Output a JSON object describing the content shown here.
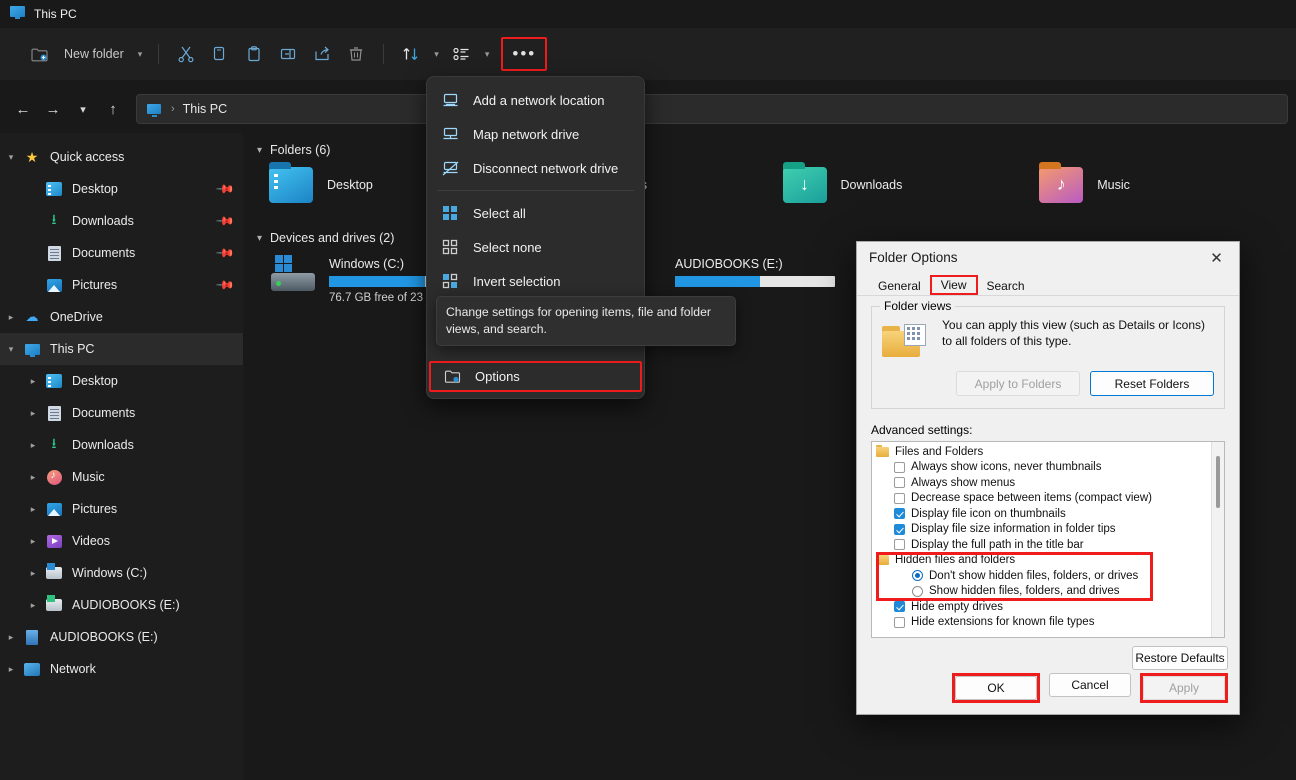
{
  "window": {
    "title": "This PC",
    "icon": "monitor-icon"
  },
  "toolbar": {
    "new_folder_label": "New folder",
    "icons": [
      "cut-icon",
      "copy-icon",
      "paste-icon",
      "rename-icon",
      "share-icon",
      "delete-icon",
      "sort-icon",
      "view-icon"
    ],
    "more_label": "•••"
  },
  "address": {
    "nav": [
      "back-arrow",
      "forward-arrow",
      "recent-chevron",
      "up-arrow"
    ],
    "crumb": "This PC"
  },
  "sidebar": {
    "items": [
      {
        "label": "Quick access",
        "icon": "star-icon",
        "expander": "chevron-down",
        "indent": 0,
        "pinned": false,
        "selected": false
      },
      {
        "label": "Desktop",
        "icon": "folder-desktop-icon",
        "expander": "",
        "indent": 1,
        "pinned": true,
        "selected": false
      },
      {
        "label": "Downloads",
        "icon": "downloads-icon",
        "expander": "",
        "indent": 1,
        "pinned": true,
        "selected": false
      },
      {
        "label": "Documents",
        "icon": "documents-icon",
        "expander": "",
        "indent": 1,
        "pinned": true,
        "selected": false
      },
      {
        "label": "Pictures",
        "icon": "pictures-icon",
        "expander": "",
        "indent": 1,
        "pinned": true,
        "selected": false
      },
      {
        "label": "OneDrive",
        "icon": "cloud-icon",
        "expander": "chevron-right",
        "indent": 0,
        "pinned": false,
        "selected": false
      },
      {
        "label": "This PC",
        "icon": "monitor-icon",
        "expander": "chevron-down",
        "indent": 0,
        "pinned": false,
        "selected": true
      },
      {
        "label": "Desktop",
        "icon": "folder-desktop-icon",
        "expander": "chevron-right",
        "indent": 1,
        "pinned": false,
        "selected": false
      },
      {
        "label": "Documents",
        "icon": "documents-icon",
        "expander": "chevron-right",
        "indent": 1,
        "pinned": false,
        "selected": false
      },
      {
        "label": "Downloads",
        "icon": "downloads-icon",
        "expander": "chevron-right",
        "indent": 1,
        "pinned": false,
        "selected": false
      },
      {
        "label": "Music",
        "icon": "music-icon",
        "expander": "chevron-right",
        "indent": 1,
        "pinned": false,
        "selected": false
      },
      {
        "label": "Pictures",
        "icon": "pictures-icon",
        "expander": "chevron-right",
        "indent": 1,
        "pinned": false,
        "selected": false
      },
      {
        "label": "Videos",
        "icon": "videos-icon",
        "expander": "chevron-right",
        "indent": 1,
        "pinned": false,
        "selected": false
      },
      {
        "label": "Windows (C:)",
        "icon": "drive-windows-icon",
        "expander": "chevron-right",
        "indent": 1,
        "pinned": false,
        "selected": false
      },
      {
        "label": "AUDIOBOOKS (E:)",
        "icon": "drive-icon",
        "expander": "chevron-right",
        "indent": 1,
        "pinned": false,
        "selected": false
      },
      {
        "label": "AUDIOBOOKS (E:)",
        "icon": "drive-flat-icon",
        "expander": "chevron-right",
        "indent": 0,
        "pinned": false,
        "selected": false
      },
      {
        "label": "Network",
        "icon": "network-icon",
        "expander": "chevron-right",
        "indent": 0,
        "pinned": false,
        "selected": false
      }
    ]
  },
  "content": {
    "folders_group": "Folders (6)",
    "folders": [
      {
        "label": "Desktop",
        "icon": "folder-desktop-icon"
      },
      {
        "label": "Documents",
        "icon": "folder-documents-icon"
      },
      {
        "label": "Downloads",
        "icon": "folder-downloads-icon"
      },
      {
        "label": "Music",
        "icon": "folder-music-icon"
      }
    ],
    "drives_group": "Devices and drives (2)",
    "drives": [
      {
        "label": "Windows (C:)",
        "free": "76.7 GB free of 23",
        "used_percent": 62
      },
      {
        "label": "AUDIOBOOKS (E:)",
        "free": "",
        "used_percent": 53
      }
    ]
  },
  "context_menu": {
    "items": [
      {
        "label": "Add a network location",
        "icon": "add-network-location-icon",
        "highlighted": false
      },
      {
        "label": "Map network drive",
        "icon": "map-network-drive-icon",
        "highlighted": false
      },
      {
        "label": "Disconnect network drive",
        "icon": "disconnect-network-drive-icon",
        "highlighted": false
      },
      {
        "label": "Select all",
        "icon": "select-all-icon",
        "highlighted": false
      },
      {
        "label": "Select none",
        "icon": "select-none-icon",
        "highlighted": false
      },
      {
        "label": "Invert selection",
        "icon": "invert-selection-icon",
        "highlighted": false
      },
      {
        "label": "Options",
        "icon": "options-icon",
        "highlighted": true
      }
    ],
    "tooltip": "Change settings for opening items, file and folder views, and search."
  },
  "dialog": {
    "title": "Folder Options",
    "close_icon": "close-icon",
    "tabs": [
      {
        "label": "General",
        "active": false,
        "marked": false
      },
      {
        "label": "View",
        "active": true,
        "marked": true
      },
      {
        "label": "Search",
        "active": false,
        "marked": false
      }
    ],
    "folder_views": {
      "legend": "Folder views",
      "description": "You can apply this view (such as Details or Icons) to all folders of this type.",
      "apply_to_folders": "Apply to Folders",
      "reset_folders": "Reset Folders"
    },
    "advanced_label": "Advanced settings:",
    "advanced_items": [
      {
        "label": "Files and Folders",
        "type": "group",
        "checked": false
      },
      {
        "label": "Always show icons, never thumbnails",
        "type": "checkbox",
        "checked": false
      },
      {
        "label": "Always show menus",
        "type": "checkbox",
        "checked": false
      },
      {
        "label": "Decrease space between items (compact view)",
        "type": "checkbox",
        "checked": false
      },
      {
        "label": "Display file icon on thumbnails",
        "type": "checkbox",
        "checked": true
      },
      {
        "label": "Display file size information in folder tips",
        "type": "checkbox",
        "checked": true
      },
      {
        "label": "Display the full path in the title bar",
        "type": "checkbox",
        "checked": false
      },
      {
        "label": "Hidden files and folders",
        "type": "group",
        "checked": false
      },
      {
        "label": "Don't show hidden files, folders, or drives",
        "type": "radio",
        "checked": true
      },
      {
        "label": "Show hidden files, folders, and drives",
        "type": "radio",
        "checked": false
      },
      {
        "label": "Hide empty drives",
        "type": "checkbox",
        "checked": true
      },
      {
        "label": "Hide extensions for known file types",
        "type": "checkbox",
        "checked": false
      }
    ],
    "restore_defaults": "Restore Defaults",
    "ok": "OK",
    "cancel": "Cancel",
    "apply": "Apply"
  },
  "highlight_color": "#ee1c1c"
}
